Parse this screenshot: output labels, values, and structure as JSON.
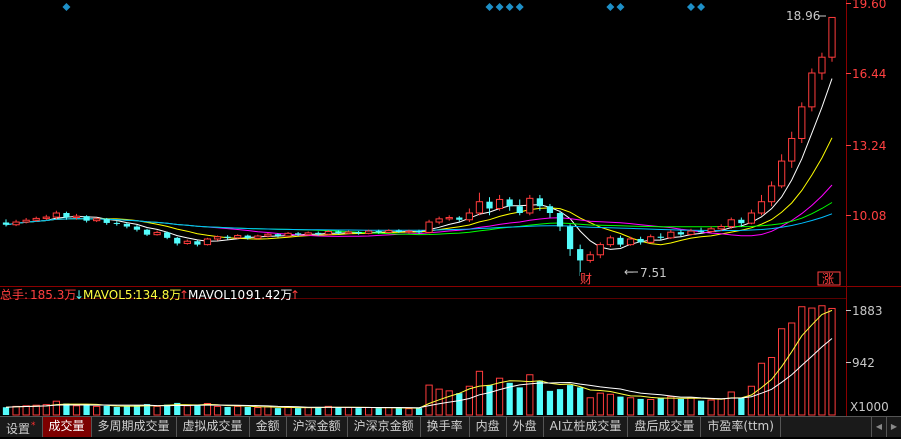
{
  "price_axis": {
    "ticks": [
      "19.60",
      "16.44",
      "13.24",
      "10.08"
    ]
  },
  "volume_axis": {
    "ticks": [
      "1883",
      "942"
    ],
    "unit": "X1000"
  },
  "annotations": {
    "high_label": "18.96",
    "low_label": "7.51",
    "event_marker": "财",
    "limit_marker": "涨"
  },
  "volume_legend": {
    "total_label": "总手:",
    "total_value": "185.3万",
    "ma5_label": "MAVOL5:",
    "ma5_value": "134.8万",
    "ma10_label": "MAVOL10:",
    "ma10_value": "91.42万"
  },
  "tabs": [
    {
      "label": "设置",
      "badge": "*"
    },
    {
      "label": "成交量",
      "active": true
    },
    {
      "label": "多周期成交量"
    },
    {
      "label": "虚拟成交量"
    },
    {
      "label": "金额"
    },
    {
      "label": "沪深金额"
    },
    {
      "label": "沪深京金额"
    },
    {
      "label": "换手率"
    },
    {
      "label": "内盘"
    },
    {
      "label": "外盘"
    },
    {
      "label": "AI立桩成交量"
    },
    {
      "label": "盘后成交量"
    },
    {
      "label": "市盈率(ttm)"
    }
  ],
  "colors": {
    "up": "#ff3c3c",
    "down": "#54fcfc",
    "ma5": "#ffffff",
    "ma10": "#ffff00",
    "ma20": "#ff00ff",
    "ma30": "#00ff00",
    "ma60": "#00bfff",
    "grid": "#8b0000",
    "marker": "#1e90c8"
  },
  "chart_data": {
    "type": "candlestick",
    "price_range": [
      7.2,
      19.6
    ],
    "volume_range_thousand": [
      0,
      2000
    ],
    "markers_at_candle_index": [
      6,
      48,
      49,
      50,
      51,
      60,
      61,
      68,
      69
    ],
    "candles": [
      [
        9.88,
        9.78,
        10.02,
        9.7,
        135
      ],
      [
        9.78,
        9.9,
        10.0,
        9.72,
        150
      ],
      [
        9.9,
        9.98,
        10.08,
        9.84,
        160
      ],
      [
        9.98,
        10.06,
        10.14,
        9.92,
        170
      ],
      [
        10.06,
        10.12,
        10.22,
        9.98,
        180
      ],
      [
        10.12,
        10.3,
        10.4,
        10.02,
        240
      ],
      [
        10.3,
        10.1,
        10.36,
        10.0,
        200
      ],
      [
        10.1,
        10.16,
        10.26,
        10.0,
        160
      ],
      [
        10.16,
        9.96,
        10.2,
        9.88,
        170
      ],
      [
        9.96,
        10.04,
        10.1,
        9.9,
        150
      ],
      [
        10.04,
        9.86,
        10.08,
        9.78,
        160
      ],
      [
        9.86,
        9.82,
        9.94,
        9.74,
        140
      ],
      [
        9.82,
        9.7,
        9.88,
        9.62,
        150
      ],
      [
        9.7,
        9.56,
        9.76,
        9.48,
        170
      ],
      [
        9.56,
        9.34,
        9.6,
        9.28,
        190
      ],
      [
        9.34,
        9.44,
        9.52,
        9.3,
        150
      ],
      [
        9.44,
        9.2,
        9.48,
        9.14,
        180
      ],
      [
        9.2,
        8.95,
        9.24,
        8.86,
        210
      ],
      [
        8.95,
        9.05,
        9.12,
        8.9,
        160
      ],
      [
        9.05,
        8.9,
        9.1,
        8.82,
        170
      ],
      [
        8.9,
        9.15,
        9.2,
        8.86,
        200
      ],
      [
        9.15,
        9.25,
        9.3,
        9.08,
        150
      ],
      [
        9.25,
        9.2,
        9.32,
        9.12,
        140
      ],
      [
        9.2,
        9.3,
        9.36,
        9.16,
        150
      ],
      [
        9.3,
        9.18,
        9.34,
        9.12,
        140
      ],
      [
        9.18,
        9.28,
        9.34,
        9.14,
        130
      ],
      [
        9.28,
        9.36,
        9.42,
        9.22,
        140
      ],
      [
        9.36,
        9.28,
        9.4,
        9.22,
        120
      ],
      [
        9.28,
        9.4,
        9.46,
        9.24,
        130
      ],
      [
        9.4,
        9.34,
        9.46,
        9.28,
        120
      ],
      [
        9.34,
        9.42,
        9.48,
        9.3,
        130
      ],
      [
        9.42,
        9.36,
        9.48,
        9.3,
        140
      ],
      [
        9.36,
        9.48,
        9.54,
        9.32,
        150
      ],
      [
        9.48,
        9.4,
        9.52,
        9.36,
        130
      ],
      [
        9.4,
        9.46,
        9.52,
        9.36,
        130
      ],
      [
        9.46,
        9.4,
        9.5,
        9.34,
        120
      ],
      [
        9.4,
        9.5,
        9.56,
        9.36,
        130
      ],
      [
        9.5,
        9.44,
        9.56,
        9.38,
        120
      ],
      [
        9.44,
        9.52,
        9.58,
        9.4,
        130
      ],
      [
        9.52,
        9.46,
        9.58,
        9.42,
        120
      ],
      [
        9.46,
        9.5,
        9.56,
        9.4,
        110
      ],
      [
        9.5,
        9.44,
        9.56,
        9.38,
        120
      ],
      [
        9.44,
        9.9,
        10.0,
        9.4,
        520
      ],
      [
        9.9,
        10.04,
        10.14,
        9.8,
        450
      ],
      [
        10.04,
        10.1,
        10.2,
        9.96,
        420
      ],
      [
        10.1,
        10.0,
        10.16,
        9.92,
        380
      ],
      [
        10.0,
        10.3,
        10.5,
        9.9,
        500
      ],
      [
        10.3,
        10.8,
        11.2,
        10.2,
        760
      ],
      [
        10.8,
        10.5,
        11.0,
        10.2,
        520
      ],
      [
        10.5,
        10.9,
        11.1,
        10.4,
        640
      ],
      [
        10.9,
        10.6,
        11.0,
        10.4,
        560
      ],
      [
        10.6,
        10.3,
        10.9,
        10.2,
        480
      ],
      [
        10.3,
        10.95,
        11.1,
        10.2,
        700
      ],
      [
        10.95,
        10.6,
        11.1,
        10.4,
        600
      ],
      [
        10.6,
        10.3,
        10.7,
        10.1,
        420
      ],
      [
        10.3,
        9.7,
        10.4,
        9.5,
        450
      ],
      [
        9.7,
        8.7,
        9.8,
        8.4,
        520
      ],
      [
        8.7,
        8.2,
        8.9,
        7.51,
        480
      ],
      [
        8.2,
        8.45,
        8.6,
        8.1,
        300
      ],
      [
        8.45,
        8.9,
        9.0,
        8.3,
        380
      ],
      [
        8.9,
        9.2,
        9.3,
        8.8,
        360
      ],
      [
        9.2,
        8.9,
        9.3,
        8.8,
        320
      ],
      [
        8.9,
        9.15,
        9.25,
        8.85,
        300
      ],
      [
        9.15,
        9.0,
        9.25,
        8.9,
        280
      ],
      [
        9.0,
        9.25,
        9.35,
        8.95,
        270
      ],
      [
        9.25,
        9.2,
        9.4,
        9.1,
        300
      ],
      [
        9.2,
        9.45,
        9.55,
        9.15,
        320
      ],
      [
        9.45,
        9.35,
        9.55,
        9.25,
        280
      ],
      [
        9.35,
        9.5,
        9.6,
        9.3,
        300
      ],
      [
        9.5,
        9.48,
        9.65,
        9.4,
        250
      ],
      [
        9.48,
        9.6,
        9.7,
        9.42,
        260
      ],
      [
        9.6,
        9.7,
        9.8,
        9.5,
        280
      ],
      [
        9.7,
        10.0,
        10.1,
        9.6,
        400
      ],
      [
        10.0,
        9.85,
        10.1,
        9.7,
        300
      ],
      [
        9.85,
        10.3,
        10.45,
        9.8,
        500
      ],
      [
        10.3,
        10.8,
        11.1,
        10.2,
        900
      ],
      [
        10.8,
        11.5,
        11.7,
        10.6,
        1000
      ],
      [
        11.5,
        12.6,
        12.9,
        11.4,
        1500
      ],
      [
        12.6,
        13.6,
        13.9,
        12.3,
        1600
      ],
      [
        13.6,
        15.0,
        15.2,
        13.4,
        1883
      ],
      [
        15.0,
        16.5,
        16.7,
        14.8,
        1860
      ],
      [
        16.5,
        17.2,
        17.4,
        16.2,
        1900
      ],
      [
        17.2,
        18.96,
        18.96,
        17.0,
        1853
      ]
    ]
  }
}
